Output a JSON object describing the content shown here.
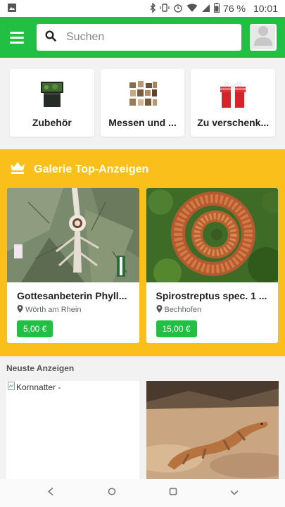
{
  "statusbar": {
    "battery": "76 %",
    "time": "10:01"
  },
  "search": {
    "placeholder": "Suchen"
  },
  "categories": [
    {
      "label": "Zubehör",
      "icon": "terrarium-icon"
    },
    {
      "label": "Messen und ...",
      "icon": "reptile-collage-icon"
    },
    {
      "label": "Zu verschenk...",
      "icon": "gift-icon"
    }
  ],
  "gallery": {
    "title": "Galerie Top-Anzeigen",
    "items": [
      {
        "name": "Gottesanbeterin Phyll...",
        "location": "Wörth am Rhein",
        "price": "5,00 €"
      },
      {
        "name": "Spirostreptus spec. 1 ...",
        "location": "Bechhofen",
        "price": "15,00 €"
      }
    ]
  },
  "neuste": {
    "title": "Neuste Anzeigen",
    "items": [
      {
        "alt": "Kornnatter -"
      }
    ]
  },
  "colors": {
    "brand_green": "#22bf45",
    "gallery_yellow": "#fbbf1b"
  }
}
